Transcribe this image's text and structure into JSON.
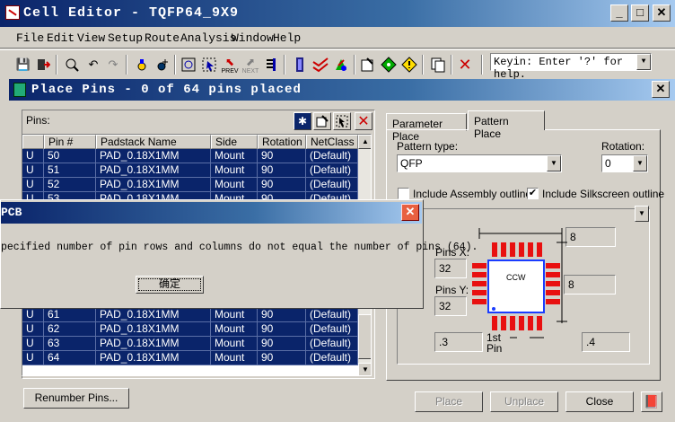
{
  "window": {
    "title": "Cell Editor - TQFP64_9X9",
    "min": "_",
    "max": "□",
    "close": "✕"
  },
  "menu": [
    "File",
    "Edit",
    "View",
    "Setup",
    "Route",
    "Analysis",
    "Window",
    "Help"
  ],
  "toolbar": {
    "keyin": "Keyin: Enter '?' for help.",
    "prev": "PREV",
    "next": "NEXT"
  },
  "dialog": {
    "title": "Place Pins - 0 of 64 pins placed",
    "close": "✕",
    "pins_label": "Pins:",
    "columns": [
      "",
      "Pin #",
      "Padstack Name",
      "Side",
      "Rotation",
      "NetClass"
    ],
    "rows_top": [
      [
        "U",
        "50",
        "PAD_0.18X1MM",
        "Mount",
        "90",
        "(Default)"
      ],
      [
        "U",
        "51",
        "PAD_0.18X1MM",
        "Mount",
        "90",
        "(Default)"
      ],
      [
        "U",
        "52",
        "PAD_0.18X1MM",
        "Mount",
        "90",
        "(Default)"
      ],
      [
        "U",
        "53",
        "PAD_0.18X1MM",
        "Mount",
        "90",
        "(Default)"
      ]
    ],
    "rows_bottom": [
      [
        "U",
        "61",
        "PAD_0.18X1MM",
        "Mount",
        "90",
        "(Default)"
      ],
      [
        "U",
        "62",
        "PAD_0.18X1MM",
        "Mount",
        "90",
        "(Default)"
      ],
      [
        "U",
        "63",
        "PAD_0.18X1MM",
        "Mount",
        "90",
        "(Default)"
      ],
      [
        "U",
        "64",
        "PAD_0.18X1MM",
        "Mount",
        "90",
        "(Default)"
      ]
    ],
    "tabs": [
      "Parameter Place",
      "Pattern Place"
    ],
    "pattern_type_label": "Pattern type:",
    "pattern_type_value": "QFP",
    "rotation_label": "Rotation:",
    "rotation_value": "0",
    "include_assembly": "Include Assembly outline",
    "include_silkscreen": "Include Silkscreen outline",
    "assembly_checked": false,
    "silkscreen_checked": true,
    "pins_x_label": "Pins X:",
    "pins_x_value": "32",
    "pins_y_label": "Pins Y:",
    "pins_y_value": "32",
    "top_dim": "8",
    "right_dim": "8",
    "pitch_left": ".3",
    "pitch_right": ".4",
    "ccw_label": "CCW",
    "first_pin_line1": "1st",
    "first_pin_line2": "Pin",
    "renumber_button": "Renumber Pins...",
    "place_button": "Place",
    "unplace_button": "Unplace",
    "close_button": "Close"
  },
  "message": {
    "title": "PCB",
    "text": "pecified number of pin rows and columns do not equal the number of pins (64).",
    "ok": "确定",
    "close": "✕"
  },
  "colors": {
    "pad": "#e81010",
    "selection": "#0a246a",
    "body_outline": "#1a3cff"
  }
}
